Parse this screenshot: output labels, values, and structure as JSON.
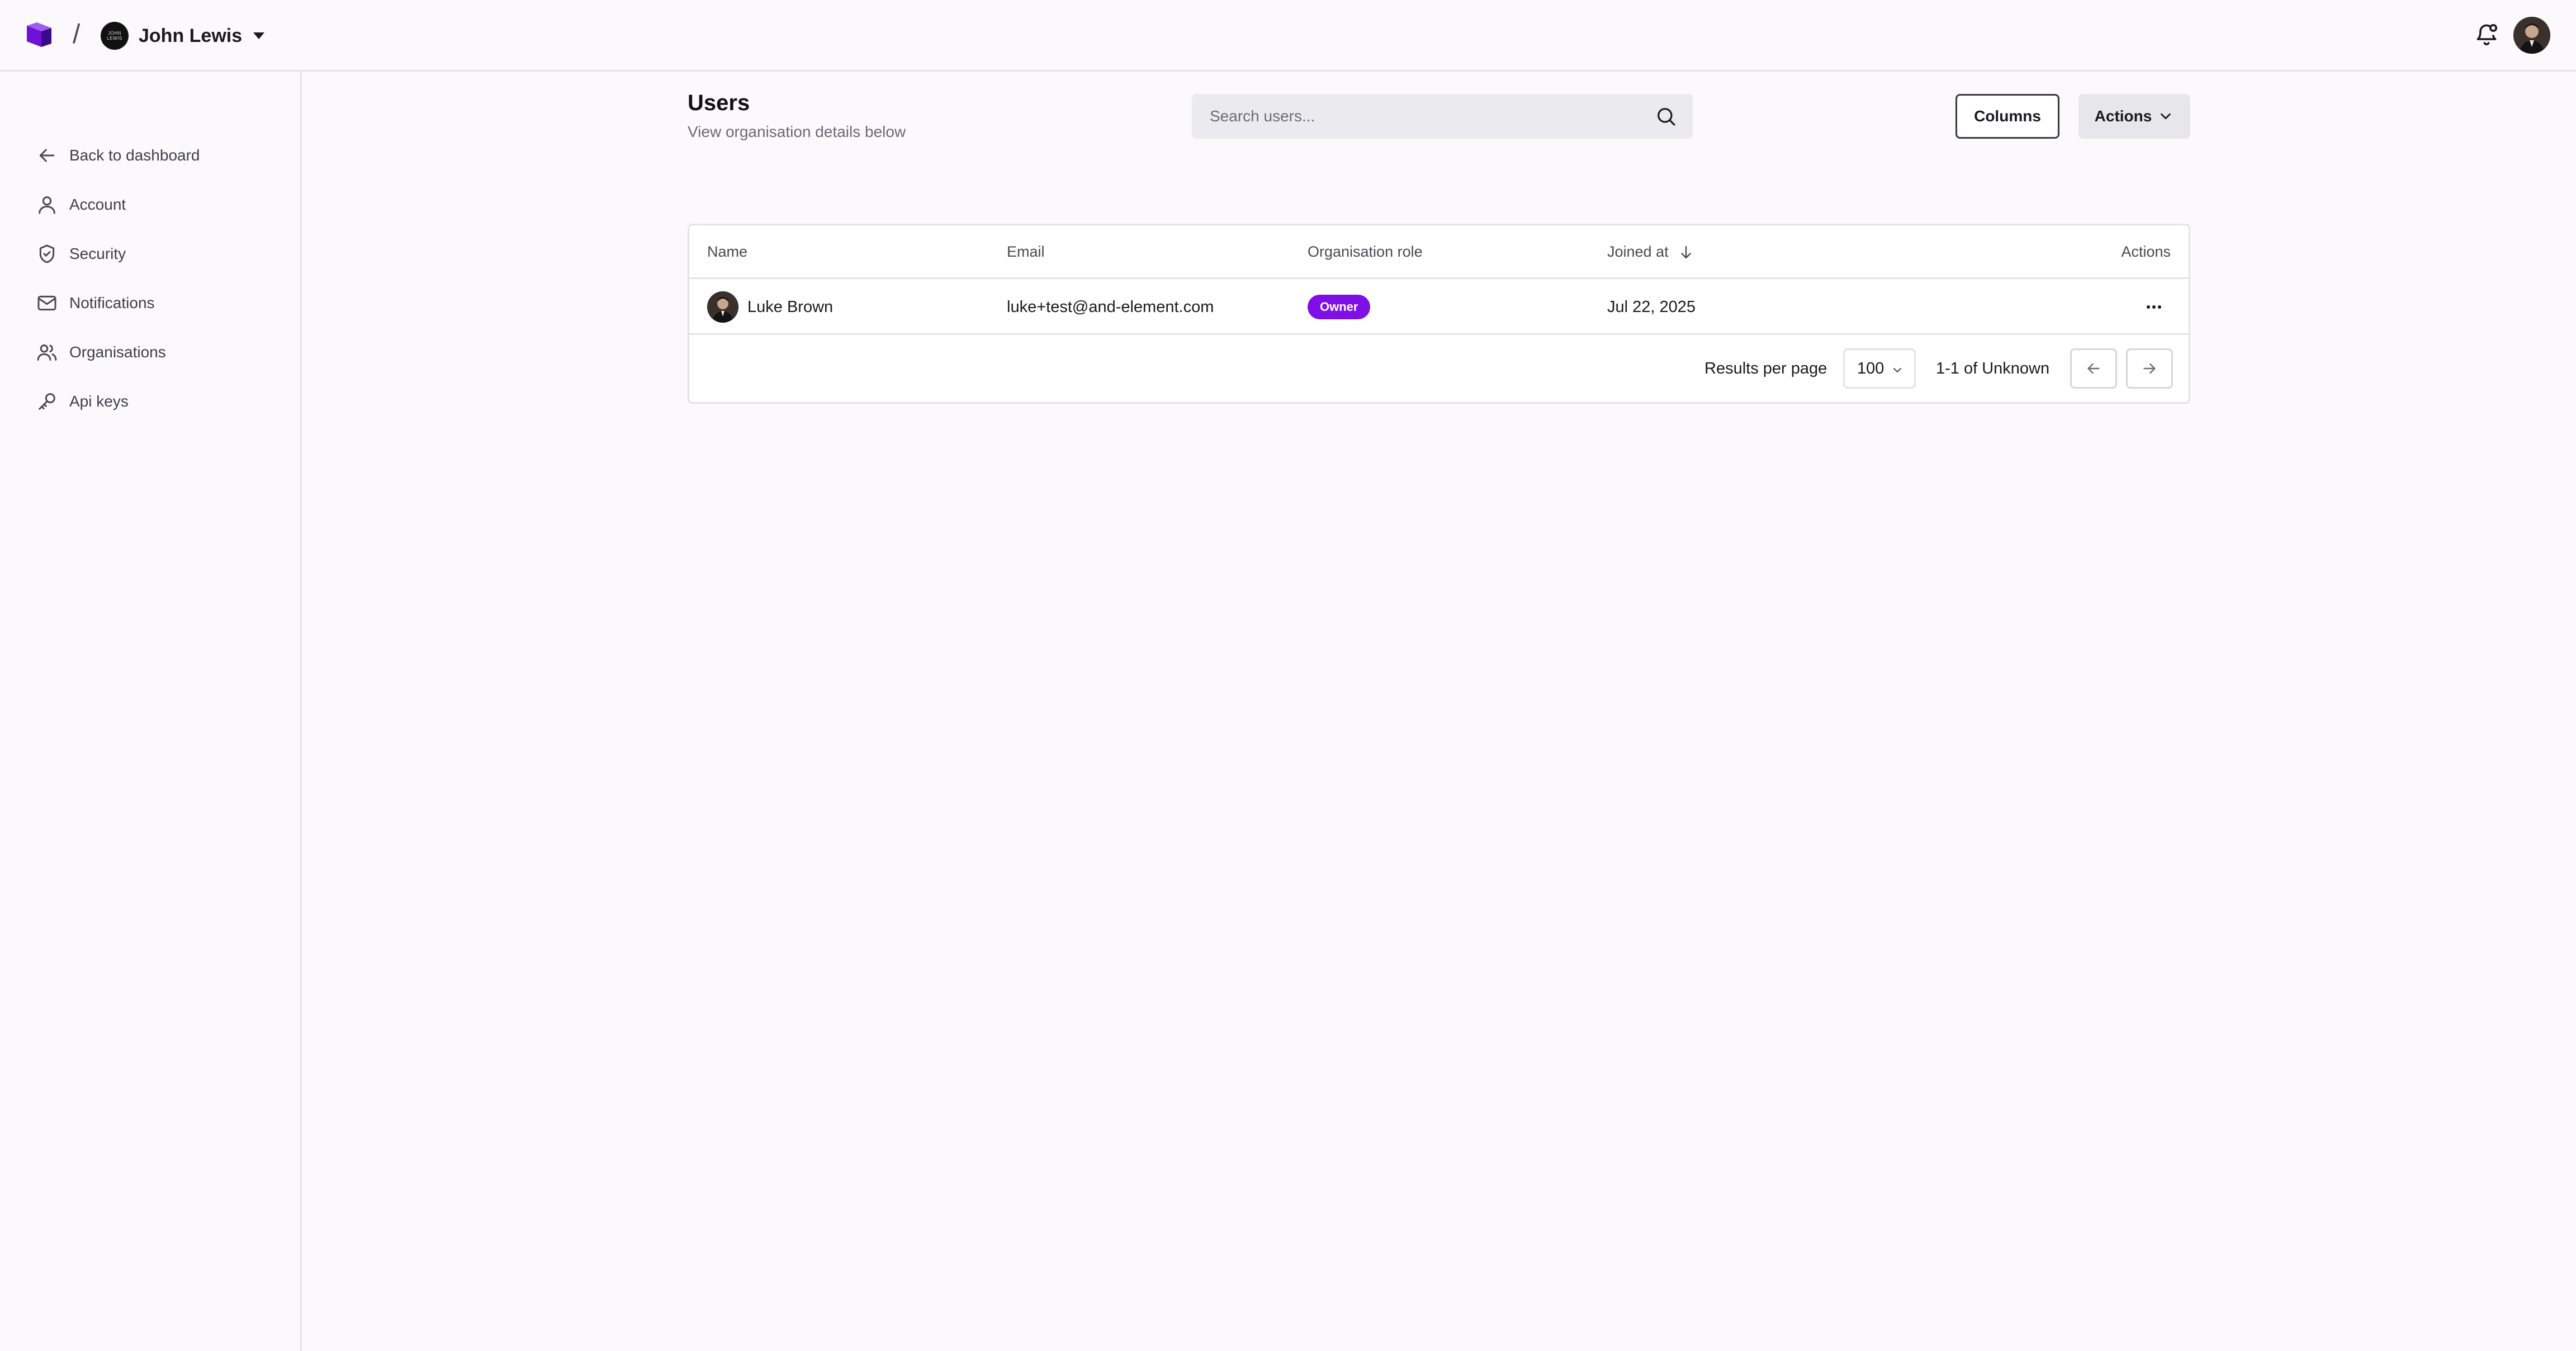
{
  "topbar": {
    "brand_icon": "cube-logo-icon",
    "separator": "/",
    "org_avatar_text": "JOHN LEWIS",
    "org_name": "John Lewis",
    "notification_icon": "bell-icon",
    "accent": "#7e0fe6"
  },
  "sidebar": {
    "items": [
      {
        "label": "Back to dashboard",
        "icon": "arrow-left-icon"
      },
      {
        "label": "Account",
        "icon": "user-icon"
      },
      {
        "label": "Security",
        "icon": "shield-icon"
      },
      {
        "label": "Notifications",
        "icon": "mail-icon"
      },
      {
        "label": "Organisations",
        "icon": "users-icon"
      },
      {
        "label": "Api keys",
        "icon": "key-icon"
      }
    ]
  },
  "main": {
    "title": "Users",
    "subtitle": "View organisation details below",
    "search": {
      "placeholder": "Search users...",
      "value": ""
    },
    "columns_label": "Columns",
    "actions_label": "Actions"
  },
  "table": {
    "headers": {
      "name": "Name",
      "email": "Email",
      "role": "Organisation role",
      "joined": "Joined at",
      "actions": "Actions"
    },
    "rows": [
      {
        "name": "Luke Brown",
        "email": "luke+test@and-element.com",
        "role": "Owner",
        "joined": "Jul 22, 2025"
      }
    ],
    "footer": {
      "results_per_page_label": "Results per page",
      "results_per_page_value": "100",
      "range": "1-1 of Unknown"
    }
  }
}
